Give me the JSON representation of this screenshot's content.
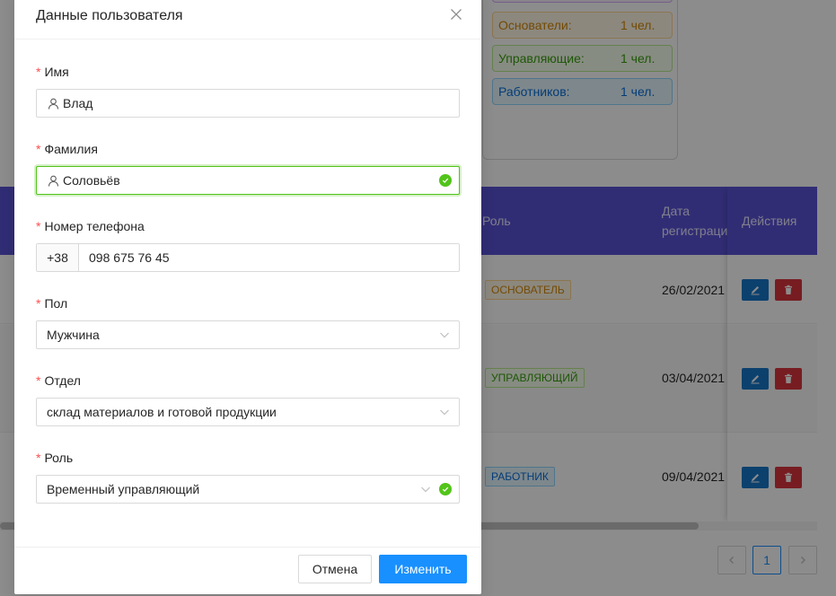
{
  "background": {
    "stats": [
      {
        "label": "",
        "count": ""
      },
      {
        "label": "Основатели:",
        "count": "1 чел."
      },
      {
        "label": "Управляющие:",
        "count": "1 чел."
      },
      {
        "label": "Работников:",
        "count": "1 чел."
      }
    ],
    "table": {
      "headers": {
        "role": "Роль",
        "date_line1": "Дата",
        "date_line2": "регистрации",
        "actions": "Действия"
      },
      "rows": [
        {
          "role": "ОСНОВАТЕЛЬ",
          "date": "26/02/2021"
        },
        {
          "role": "УПРАВЛЯЮЩИЙ",
          "date": "03/04/2021"
        },
        {
          "role": "РАБОТНИК",
          "date": "09/04/2021"
        }
      ]
    },
    "pagination": {
      "current": "1",
      "prev_icon": "chevron-left-icon",
      "next_icon": "chevron-right-icon"
    }
  },
  "modal": {
    "title": "Данные пользователя",
    "close_icon": "close-icon",
    "fields": {
      "first_name": {
        "label": "Имя",
        "value": "Влад"
      },
      "last_name": {
        "label": "Фамилия",
        "value": "Соловьёв"
      },
      "phone": {
        "label": "Номер телефона",
        "code": "+38",
        "value": "098 675 76 45"
      },
      "gender": {
        "label": "Пол",
        "value": "Мужчина"
      },
      "department": {
        "label": "Отдел",
        "value": "склад материалов и готовой продукции"
      },
      "role": {
        "label": "Роль",
        "value": "Временный управляющий"
      }
    },
    "required_mark": "*",
    "buttons": {
      "cancel": "Отмена",
      "submit": "Изменить"
    }
  },
  "colors": {
    "primary": "#1890ff",
    "success": "#52c41a",
    "table_header": "#5a52d5",
    "danger": "#d9363e"
  }
}
